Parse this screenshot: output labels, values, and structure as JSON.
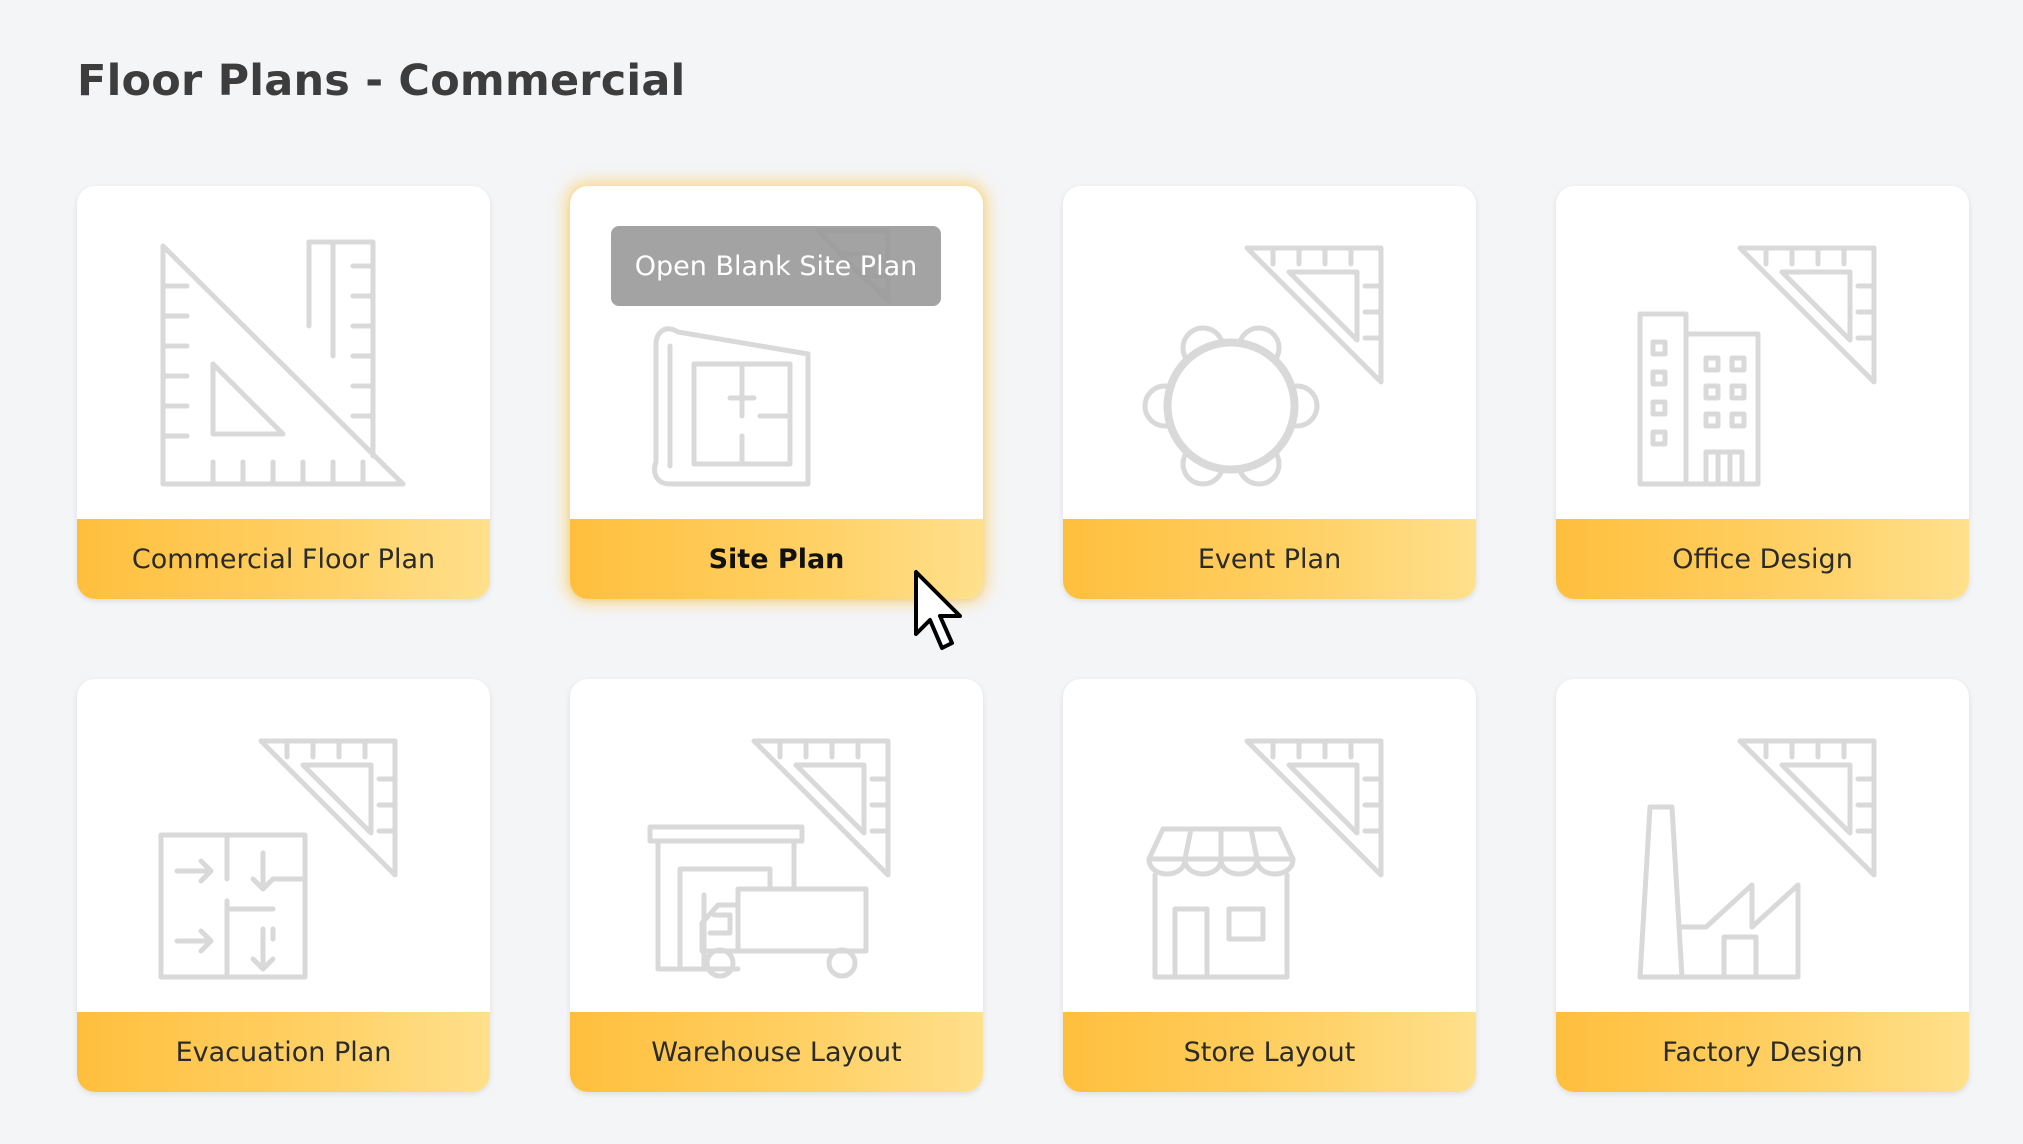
{
  "page": {
    "title": "Floor Plans - Commercial"
  },
  "templates": [
    {
      "label": "Commercial Floor Plan",
      "icon": "set-square-ruler-icon"
    },
    {
      "label": "Site Plan",
      "icon": "blueprint-icon",
      "hovered": true,
      "action_label": "Open Blank Site Plan"
    },
    {
      "label": "Event Plan",
      "icon": "round-table-icon"
    },
    {
      "label": "Office Design",
      "icon": "office-building-icon"
    },
    {
      "label": "Evacuation Plan",
      "icon": "evacuation-map-icon"
    },
    {
      "label": "Warehouse Layout",
      "icon": "warehouse-truck-icon"
    },
    {
      "label": "Store Layout",
      "icon": "storefront-icon"
    },
    {
      "label": "Factory Design",
      "icon": "factory-icon"
    }
  ],
  "colors": {
    "background": "#f4f5f7",
    "label_bar_start": "#ffbf3d",
    "label_bar_end": "#ffe08c",
    "icon_stroke": "#d9d9d9",
    "hover_glow": "#ffc442",
    "tooltip_bg": "#969696"
  }
}
